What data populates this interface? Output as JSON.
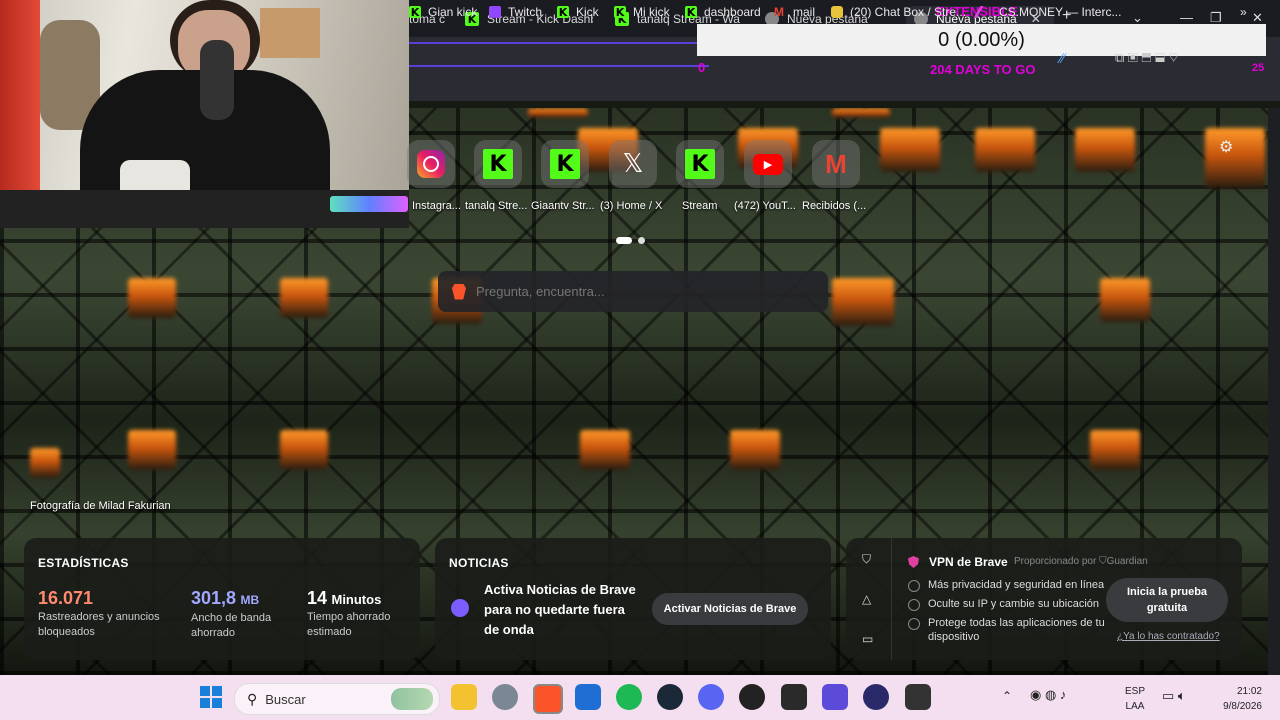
{
  "tabs": [
    {
      "label": "toma c"
    },
    {
      "label": "Stream - Kick Dashbo"
    },
    {
      "label": "tanalq Stream - Wat"
    },
    {
      "label": "Nueva pestaña"
    },
    {
      "label": "Nueva pestaña"
    }
  ],
  "overlay": {
    "counter": "0 (0.00%)",
    "extensible": "EXTENSIBLE",
    "days": "204 DAYS TO GO",
    "left_num": "0",
    "right_num": "25"
  },
  "bookmarks": [
    {
      "label": "Gian kick"
    },
    {
      "label": "Twitch"
    },
    {
      "label": "Kick"
    },
    {
      "label": "Mi kick"
    },
    {
      "label": "dashboard"
    },
    {
      "label": "mail"
    },
    {
      "label": "(20) Chat Box / Stre..."
    },
    {
      "label": "CS.MONEY — Interc..."
    }
  ],
  "top_sites": [
    {
      "label": "Instagra..."
    },
    {
      "label": "tanalq Stre..."
    },
    {
      "label": "Giaantv Str..."
    },
    {
      "label": "(3) Home / X"
    },
    {
      "label": "Stream"
    },
    {
      "label": "(472) YouT..."
    },
    {
      "label": "Recibidos (..."
    }
  ],
  "search": {
    "placeholder": "Pregunta, encuentra..."
  },
  "photo_credit": "Fotografía de Milad Fakurian",
  "stats": {
    "title": "ESTADÍSTICAS",
    "trackers_value": "16.071",
    "trackers_label_1": "Rastreadores y anuncios",
    "trackers_label_2": "bloqueados",
    "bandwidth_value": "301,8",
    "bandwidth_unit": "MB",
    "bandwidth_label_1": "Ancho de banda",
    "bandwidth_label_2": "ahorrado",
    "time_value": "14",
    "time_unit": "Minutos",
    "time_label_1": "Tiempo ahorrado",
    "time_label_2": "estimado"
  },
  "news": {
    "title": "NOTICIAS",
    "line1": "Activa Noticias de Brave",
    "line2": "para no quedarte fuera",
    "line3": "de onda",
    "button": "Activar Noticias de Brave"
  },
  "vpn": {
    "title": "VPN de Brave",
    "provided": "Proporcionado por",
    "provider": "Guardian",
    "feature1": "Más privacidad y seguridad en línea",
    "feature2": "Oculte su IP y cambie su ubicación",
    "feature3a": "Protege todas las aplicaciones de tu",
    "feature3b": "dispositivo",
    "cta1": "Inicia la prueba",
    "cta2": "gratuita",
    "link": "¿Ya lo has contratado?"
  },
  "taskbar": {
    "search": "Buscar",
    "lang1": "ESP",
    "lang2": "LAA",
    "time": "21:02",
    "date": "9/8/2026"
  },
  "colors": {
    "kick_green": "#53fc18",
    "trackers": "#ff8a70",
    "bandwidth": "#a0a8ff",
    "counter_bg": "#f1f1f1",
    "overlay_pink": "#e000d8"
  }
}
